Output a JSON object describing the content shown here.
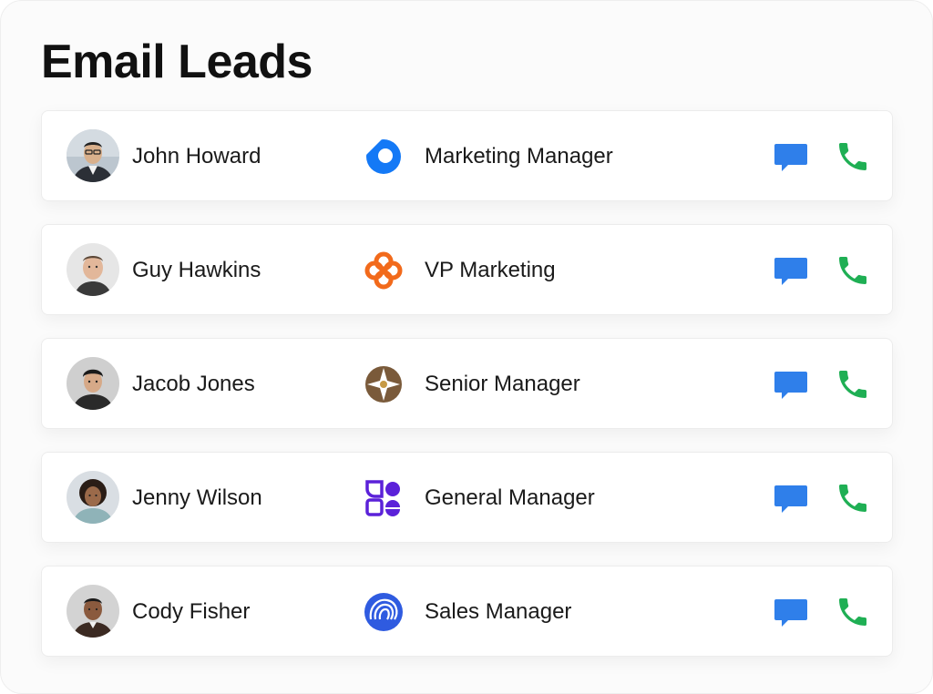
{
  "header": {
    "title": "Email Leads"
  },
  "colors": {
    "message_icon": "#2F7FEA",
    "call_icon": "#1FAF54",
    "title_text": "#111111"
  },
  "leads": [
    {
      "name": "John Howard",
      "role": "Marketing Manager",
      "avatar": "person-avatar",
      "company_logo": "blue-ring-logo-icon",
      "company_logo_color": "#1479F6"
    },
    {
      "name": "Guy Hawkins",
      "role": "VP Marketing",
      "avatar": "person-avatar",
      "company_logo": "orange-flower-logo-icon",
      "company_logo_color": "#F26A1B"
    },
    {
      "name": "Jacob Jones",
      "role": "Senior Manager",
      "avatar": "person-avatar",
      "company_logo": "brown-compass-logo-icon",
      "company_logo_color": "#7A5A3A"
    },
    {
      "name": "Jenny Wilson",
      "role": "General Manager",
      "avatar": "person-avatar",
      "company_logo": "purple-shapes-logo-icon",
      "company_logo_color": "#5B21D9"
    },
    {
      "name": "Cody Fisher",
      "role": "Sales Manager",
      "avatar": "person-avatar",
      "company_logo": "blue-spiral-logo-icon",
      "company_logo_color": "#2F5BE0"
    }
  ],
  "actions": {
    "message_icon": "chat-bubble-icon",
    "call_icon": "phone-icon"
  }
}
